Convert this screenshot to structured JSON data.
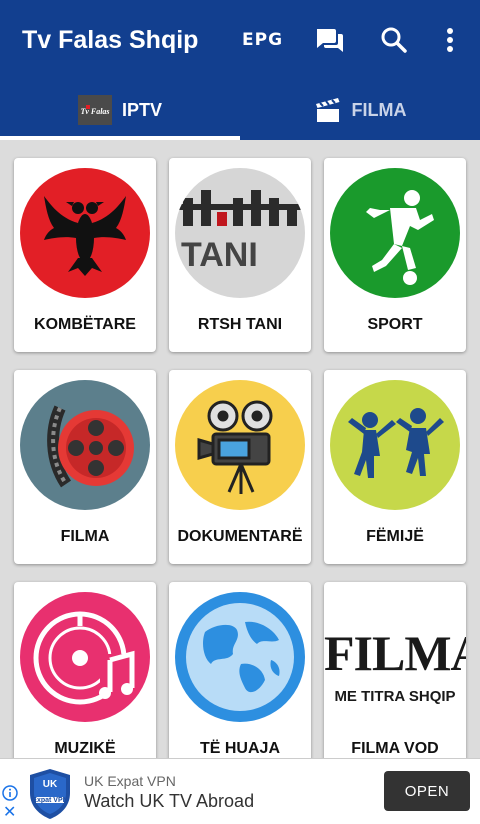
{
  "appbar": {
    "title": "Tv Falas Shqip",
    "epg_label": "EPG",
    "icons": [
      "chat-icon",
      "search-icon",
      "more-vert-icon"
    ],
    "color": "#123f8f"
  },
  "tabs": [
    {
      "label": "IPTV",
      "icon": "tvfalas-logo-icon",
      "selected": true
    },
    {
      "label": "FILMA",
      "icon": "clapperboard-icon",
      "selected": false
    }
  ],
  "categories": [
    {
      "label": "KOMBËTARE",
      "icon": "albanian-eagle-icon",
      "color": "#e21f26"
    },
    {
      "label": "RTSH TANI",
      "icon": "rtsh-tani-logo",
      "logo_text": "TANI",
      "color": "#d6d6d6"
    },
    {
      "label": "SPORT",
      "icon": "soccer-player-icon",
      "color": "#1a9a2c"
    },
    {
      "label": "FILMA",
      "icon": "film-reel-icon",
      "color": "#5c7f8c"
    },
    {
      "label": "DOKUMENTARË",
      "icon": "movie-camera-icon",
      "color": "#f7cf4d"
    },
    {
      "label": "FËMIJË",
      "icon": "kids-icon",
      "color": "#c6d84a"
    },
    {
      "label": "MUZIKË",
      "icon": "music-disc-icon",
      "color": "#e8306f"
    },
    {
      "label": "TË HUAJA",
      "icon": "globe-icon",
      "color": "#2d8fe0"
    },
    {
      "label": "FILMA VOD",
      "icon": "filma-text-logo",
      "logo_big": "FILMA",
      "logo_small": "ME TITRA SHQIP",
      "color": "#ffffff"
    }
  ],
  "ad": {
    "logo_line1": "UK",
    "logo_line2": "Expat VPN",
    "sponsor": "UK Expat VPN",
    "headline": "Watch UK TV Abroad",
    "button": "OPEN",
    "icons": [
      "ad-info-icon",
      "ad-close-icon"
    ]
  }
}
